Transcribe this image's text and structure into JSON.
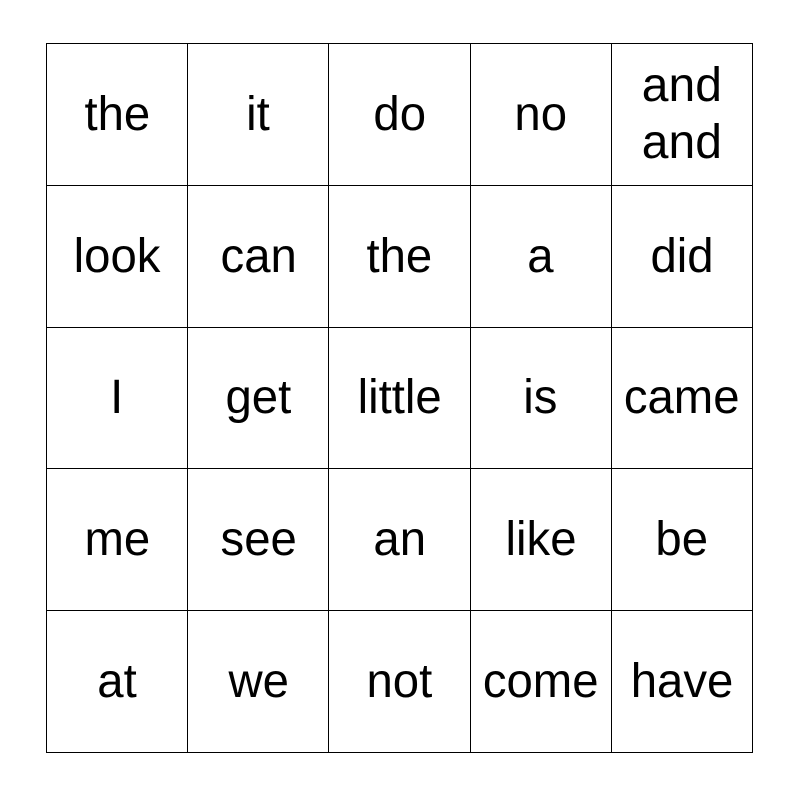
{
  "card": {
    "type": "bingo-card",
    "rows": 5,
    "columns": 5,
    "background_color": "#ffffff",
    "border_color": "#000000",
    "text_color": "#000000",
    "grid": [
      [
        {
          "text": "the",
          "fit": false,
          "wrap": false
        },
        {
          "text": "it",
          "fit": false,
          "wrap": false
        },
        {
          "text": "do",
          "fit": false,
          "wrap": false
        },
        {
          "text": "no",
          "fit": false,
          "wrap": false
        },
        {
          "text": "and and",
          "fit": false,
          "wrap": true
        }
      ],
      [
        {
          "text": "look",
          "fit": true,
          "wrap": false
        },
        {
          "text": "can",
          "fit": false,
          "wrap": false
        },
        {
          "text": "the",
          "fit": false,
          "wrap": false
        },
        {
          "text": "a",
          "fit": false,
          "wrap": false
        },
        {
          "text": "did",
          "fit": false,
          "wrap": false
        }
      ],
      [
        {
          "text": "I",
          "fit": false,
          "wrap": false
        },
        {
          "text": "get",
          "fit": false,
          "wrap": false
        },
        {
          "text": "little",
          "fit": true,
          "wrap": false
        },
        {
          "text": "is",
          "fit": false,
          "wrap": false
        },
        {
          "text": "came",
          "fit": true,
          "wrap": false
        }
      ],
      [
        {
          "text": "me",
          "fit": false,
          "wrap": false
        },
        {
          "text": "see",
          "fit": false,
          "wrap": false
        },
        {
          "text": "an",
          "fit": false,
          "wrap": false
        },
        {
          "text": "like",
          "fit": false,
          "wrap": false
        },
        {
          "text": "be",
          "fit": false,
          "wrap": false
        }
      ],
      [
        {
          "text": "at",
          "fit": false,
          "wrap": false
        },
        {
          "text": "we",
          "fit": false,
          "wrap": false
        },
        {
          "text": "not",
          "fit": false,
          "wrap": false
        },
        {
          "text": "come",
          "fit": true,
          "wrap": false
        },
        {
          "text": "have",
          "fit": true,
          "wrap": false
        }
      ]
    ]
  }
}
